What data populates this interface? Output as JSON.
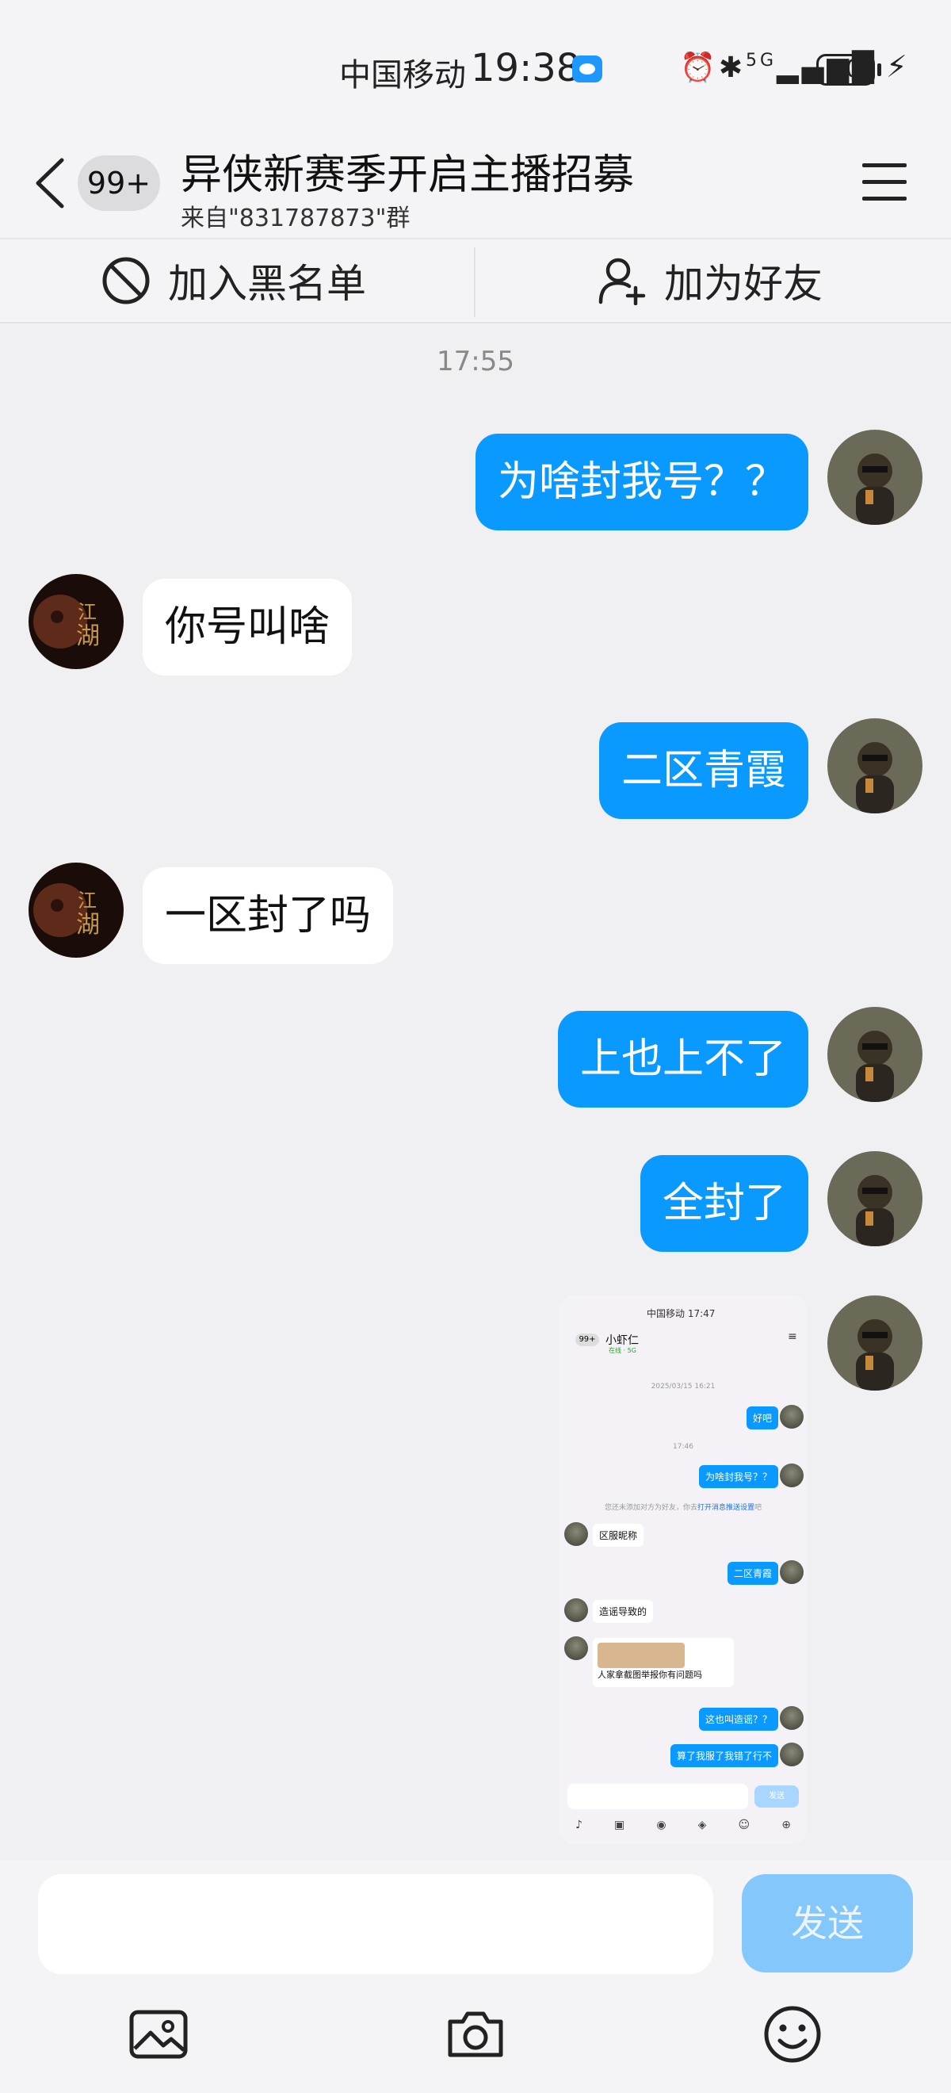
{
  "status_bar": {
    "carrier": "中国移动",
    "time": "19:38",
    "icons": [
      "alarm-icon",
      "bluetooth-icon",
      "5g-signal-icon",
      "battery-icon",
      "charging-icon"
    ],
    "network": "5G",
    "battery": "70"
  },
  "header": {
    "unread_count": "99+",
    "title": "异侠新赛季开启主播招募",
    "subtitle": "来自\"831787873\"群"
  },
  "actions": {
    "blacklist_label": "加入黑名单",
    "add_friend_label": "加为好友"
  },
  "timestamp": "17:55",
  "messages": [
    {
      "dir": "out",
      "text": "为啥封我号？？"
    },
    {
      "dir": "in",
      "text": "你号叫啥"
    },
    {
      "dir": "out",
      "text": "二区青霞"
    },
    {
      "dir": "in",
      "text": "一区封了吗"
    },
    {
      "dir": "out",
      "text": "上也上不了"
    },
    {
      "dir": "out",
      "text": "全封了"
    }
  ],
  "screenshot": {
    "status": "中国移动 17:47",
    "badge": "99+",
    "title": "小虾仁",
    "online": "在线 · 5G",
    "date": "2025/03/15 16:21",
    "time2": "17:46",
    "notice_prefix": "您还未添加对方为好友，你去",
    "notice_link": "打开消息推送设置",
    "notice_suffix": "吧",
    "msgs": {
      "m1": "好吧",
      "m2": "为啥封我号？？",
      "m3": "区服昵称",
      "m4": "二区青霞",
      "m5": "造谣导致的",
      "m6": "人家拿截图举报你有问题吗",
      "m7": "这也叫造谣？？",
      "m8": "算了我服了我错了行不"
    },
    "send": "发送"
  },
  "input": {
    "placeholder": "",
    "send_label": "发送"
  },
  "colors": {
    "bubble_out": "#0a99ff",
    "bubble_in": "#ffffff",
    "send_disabled": "#84c7fb",
    "background": "#f0f0f2"
  }
}
